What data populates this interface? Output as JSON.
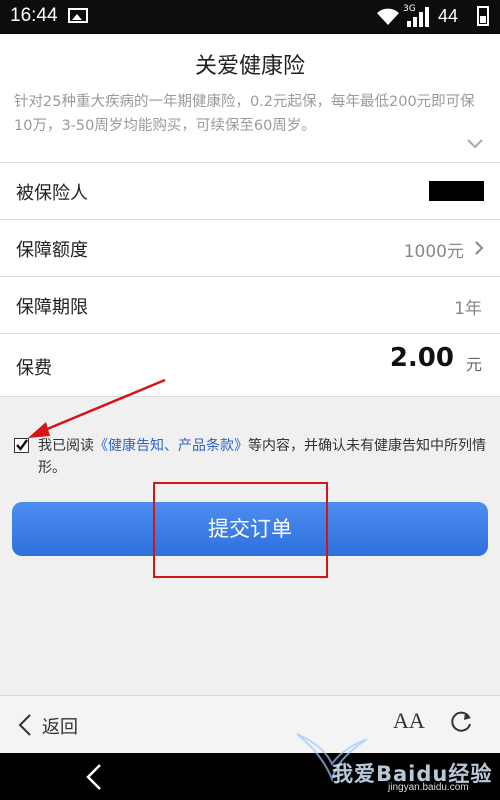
{
  "status_bar": {
    "time": "16:44",
    "network_label": "3G",
    "battery": "44"
  },
  "product": {
    "title": "关爱健康险",
    "description": "针对25种重大疾病的一年期健康险，0.2元起保，每年最低200元即可保10万，3-50周岁均能购买，可续保至60周岁。"
  },
  "form": {
    "insured_label": "被保险人",
    "coverage_label": "保障额度",
    "coverage_value": "1000元",
    "period_label": "保障期限",
    "period_value": "1年",
    "premium_label": "保费",
    "premium_amount": "2.00",
    "premium_unit": "元"
  },
  "agreement": {
    "prefix": "我已阅读",
    "link": "《健康告知、产品条款》",
    "suffix": "等内容，并确认未有健康告知中所列情形。",
    "checked": true
  },
  "submit_label": "提交订单",
  "bottom_bar": {
    "back_label": "返回",
    "font_label": "AA"
  },
  "watermark": {
    "text": "我爱Baidu经验",
    "url": "jingyan.baidu.com"
  },
  "colors": {
    "button": "#3a7de6",
    "link": "#2d66c8",
    "annotation": "#d51515"
  }
}
